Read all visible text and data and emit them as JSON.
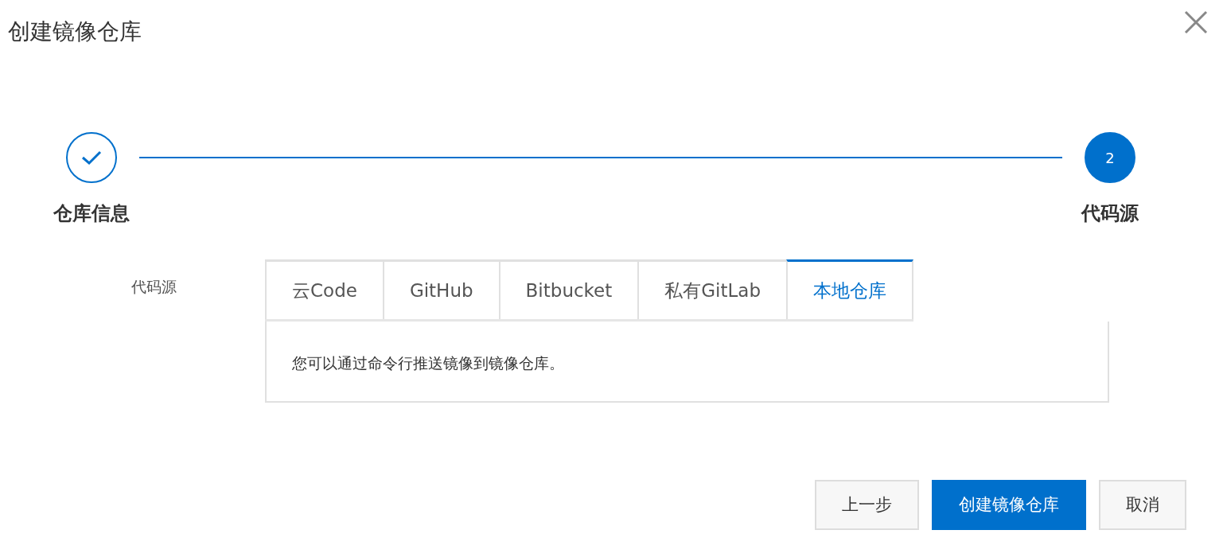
{
  "dialog": {
    "title": "创建镜像仓库"
  },
  "steps": [
    {
      "label": "仓库信息",
      "completed": true,
      "current": false
    },
    {
      "label": "代码源",
      "number": "2",
      "completed": false,
      "current": true
    }
  ],
  "form": {
    "label": "代码源",
    "tabs": [
      {
        "label": "云Code",
        "selected": false
      },
      {
        "label": "GitHub",
        "selected": false
      },
      {
        "label": "Bitbucket",
        "selected": false
      },
      {
        "label": "私有GitLab",
        "selected": false
      },
      {
        "label": "本地仓库",
        "selected": true
      }
    ],
    "panel_text": "您可以通过命令行推送镜像到镜像仓库。"
  },
  "buttons": [
    {
      "label": "上一步",
      "kind": "secondary"
    },
    {
      "label": "创建镜像仓库",
      "kind": "primary"
    },
    {
      "label": "取消",
      "kind": "secondary"
    }
  ]
}
